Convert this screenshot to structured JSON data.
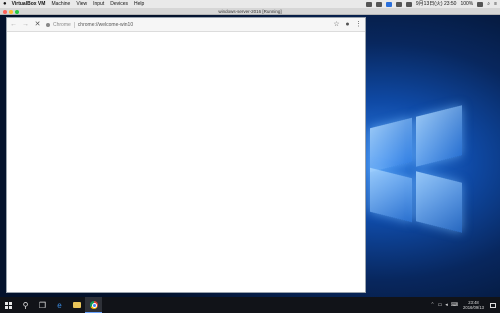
{
  "mac_menubar": {
    "app_name": "VirtualBox VM",
    "menus": [
      "Machine",
      "View",
      "Input",
      "Devices",
      "Help"
    ],
    "battery": "100%",
    "datetime": "9月13日(火) 23:50"
  },
  "vm_window": {
    "title": "windows-server-2016 [Running]"
  },
  "browser": {
    "scheme_label": "Chrome",
    "url": "chrome://welcome-win10",
    "icons": [
      "back-icon",
      "forward-icon",
      "stop-icon",
      "star-icon",
      "account-icon",
      "menu-icon"
    ]
  },
  "taskbar": {
    "time": "23:48",
    "date": "2016/09/13",
    "icons": [
      "start-icon",
      "search-icon",
      "task-view-icon",
      "edge-icon",
      "file-explorer-icon",
      "chrome-icon"
    ]
  },
  "colors": {
    "menubar_bg": "#e9e9e9",
    "taskbar_bg": "#111318",
    "desktop_accent": "#2f7fe6"
  }
}
